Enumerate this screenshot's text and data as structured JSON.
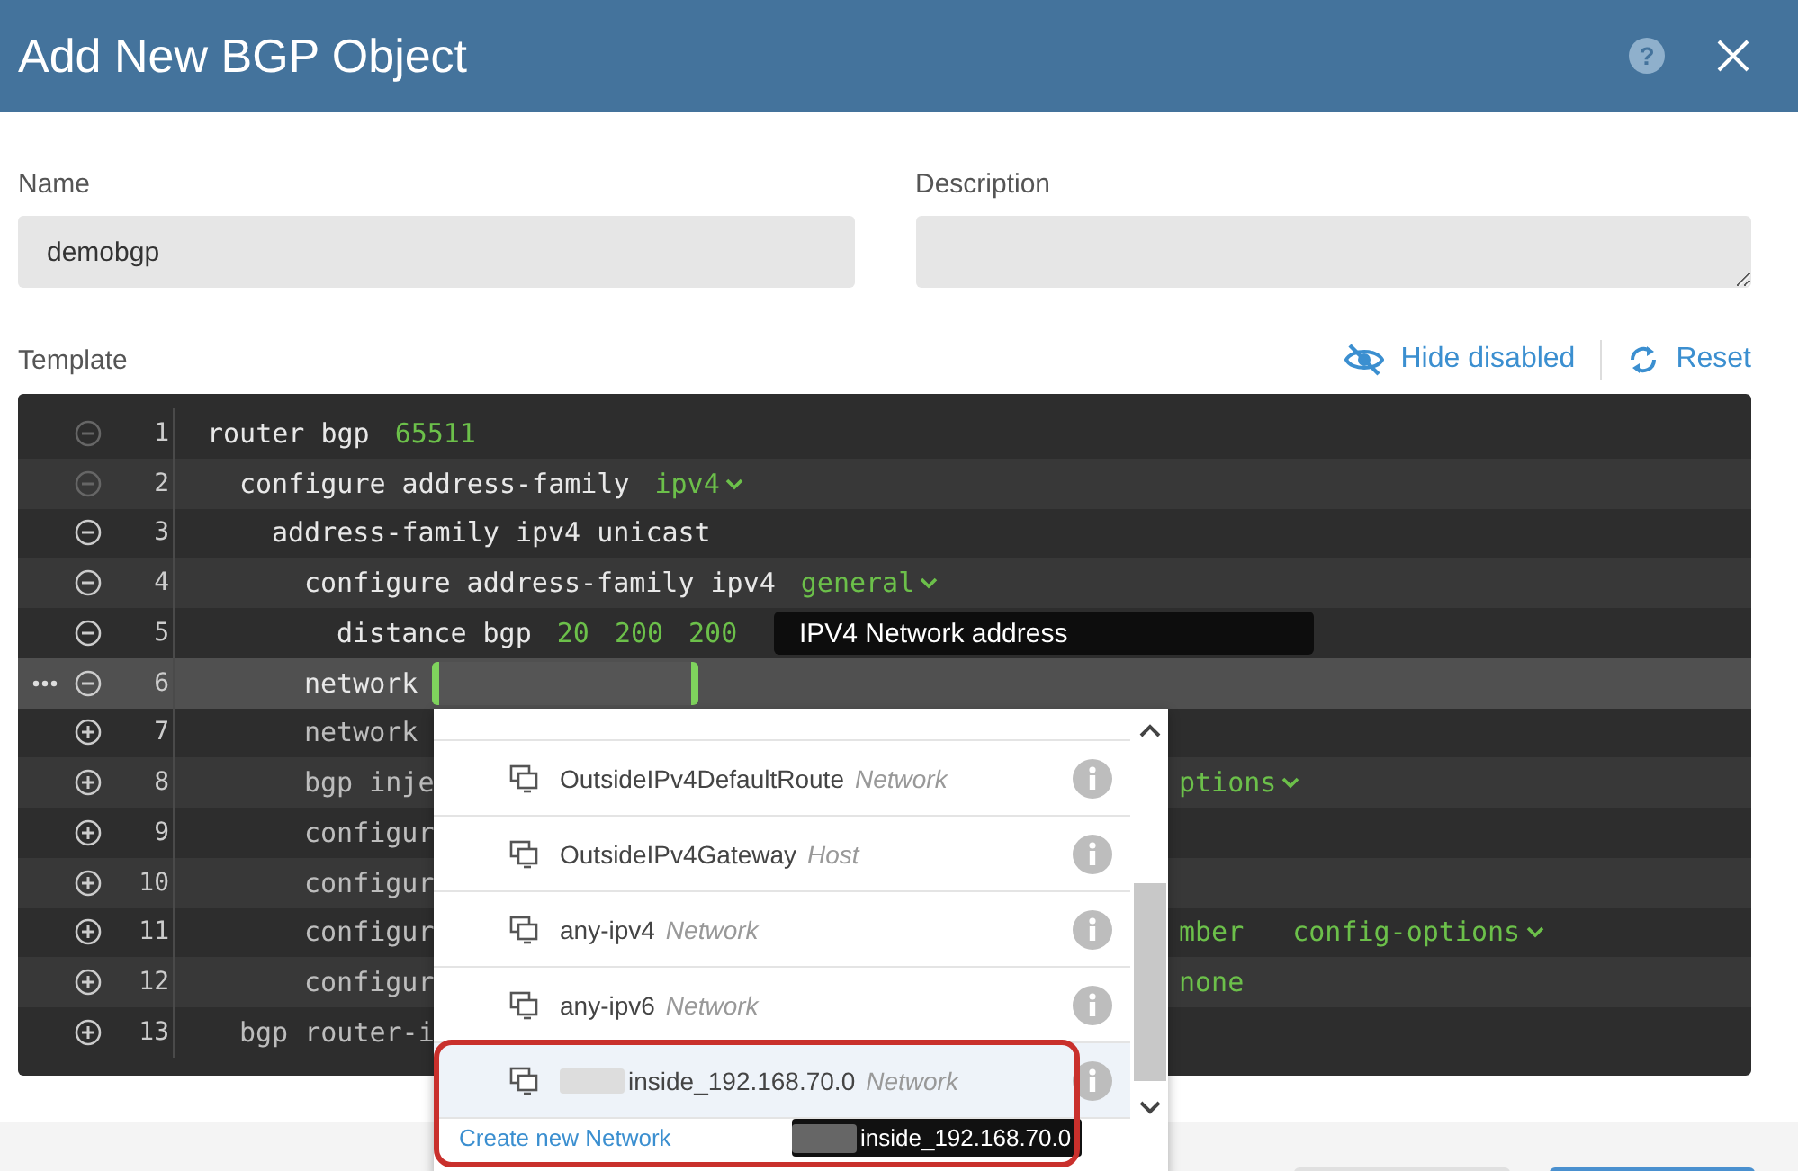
{
  "window": {
    "title": "Add New BGP Object",
    "help_icon": "?"
  },
  "form": {
    "name": {
      "label": "Name",
      "value": "demobgp"
    },
    "description": {
      "label": "Description"
    }
  },
  "template": {
    "label": "Template",
    "hide_disabled": "Hide disabled",
    "reset": "Reset"
  },
  "code_lines": [
    {
      "number": "1",
      "kind": "fixed",
      "selected": false,
      "text": "router bgp",
      "params": [
        {
          "kind": "value",
          "text": "65511"
        }
      ],
      "children": [
        {
          "number": "2",
          "kind": "fixed",
          "selected": false,
          "text": "configure address-family",
          "params": [
            {
              "kind": "select",
              "text": "ipv4"
            }
          ],
          "children": [
            {
              "number": "3",
              "kind": "remove",
              "selected": false,
              "text": "address-family ipv4 unicast",
              "children": [
                {
                  "number": "4",
                  "kind": "remove",
                  "selected": false,
                  "text": "configure address-family ipv4",
                  "params": [
                    {
                      "kind": "select",
                      "text": "general"
                    }
                  ],
                  "children": [
                    {
                      "number": "5",
                      "kind": "remove",
                      "selected": false,
                      "text": "distance bgp",
                      "params": [
                        {
                          "kind": "value",
                          "text": "20"
                        },
                        {
                          "kind": "value",
                          "text": "200"
                        },
                        {
                          "kind": "value",
                          "text": "200"
                        }
                      ]
                    }
                  ]
                },
                {
                  "number": "6",
                  "kind": "remove",
                  "selected": true,
                  "text": "network",
                  "params": [
                    {
                      "kind": "input"
                    }
                  ]
                },
                {
                  "number": "7",
                  "kind": "add",
                  "selected": false,
                  "text": "network"
                },
                {
                  "number": "8",
                  "kind": "add",
                  "selected": false,
                  "text": "bgp inje",
                  "tail": [
                    {
                      "kind": "select",
                      "text": "ptions"
                    }
                  ]
                },
                {
                  "number": "9",
                  "kind": "add",
                  "selected": false,
                  "text": "configur"
                },
                {
                  "number": "10",
                  "kind": "add",
                  "selected": false,
                  "text": "configur"
                },
                {
                  "number": "11",
                  "kind": "add",
                  "selected": false,
                  "text": "configur",
                  "tail": [
                    {
                      "kind": "value",
                      "text": "mber"
                    },
                    {
                      "kind": "select",
                      "text": "config-options"
                    }
                  ]
                },
                {
                  "number": "12",
                  "kind": "add",
                  "selected": false,
                  "text": "configur",
                  "tail": [
                    {
                      "kind": "value",
                      "text": "none"
                    }
                  ]
                }
              ]
            }
          ]
        },
        {
          "number": "13",
          "kind": "add",
          "selected": false,
          "text": "bgp router-i"
        }
      ]
    }
  ],
  "field_tooltip": "IPV4 Network address",
  "dropdown": {
    "items": [
      {
        "name": "OutsideIPv4DefaultRoute",
        "type": "Network",
        "selected": false,
        "redacted": false
      },
      {
        "name": "OutsideIPv4Gateway",
        "type": "Host",
        "selected": false,
        "redacted": false
      },
      {
        "name": "any-ipv4",
        "type": "Network",
        "selected": false,
        "redacted": false
      },
      {
        "name": "any-ipv6",
        "type": "Network",
        "selected": false,
        "redacted": false
      },
      {
        "name": "inside_192.168.70.0",
        "type": "Network",
        "selected": true,
        "redacted": true
      }
    ],
    "hover_tooltip": {
      "text": "inside_192.168.70.0",
      "redacted": true
    },
    "create_link": "Create new Network"
  }
}
